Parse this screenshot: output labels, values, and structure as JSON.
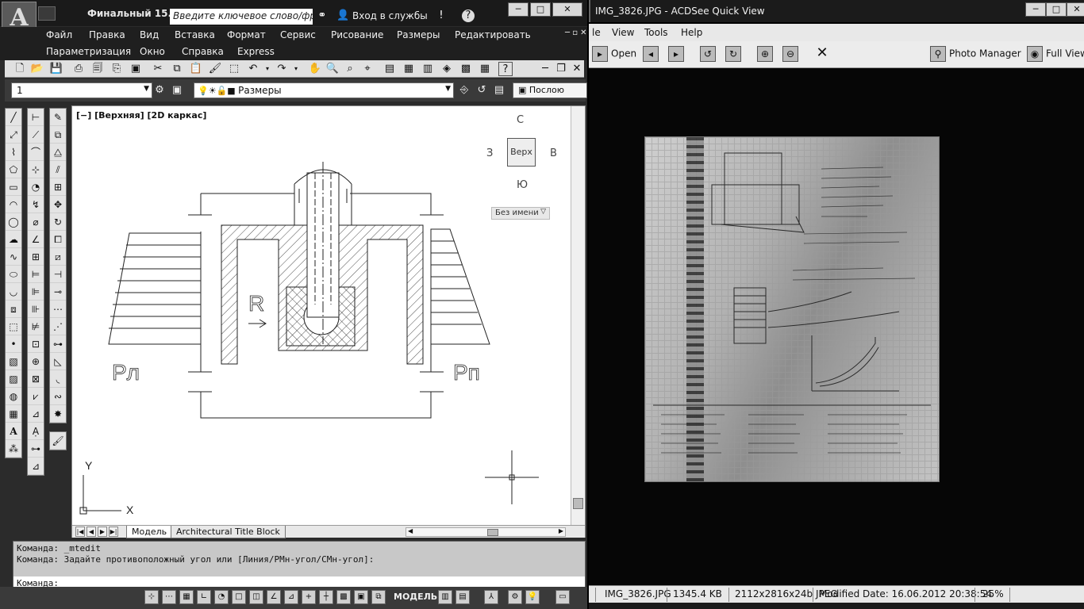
{
  "autocad": {
    "doc_title": "Финальный 15...",
    "search_placeholder": "Введите ключевое слово/фразу",
    "sign_in": "Вход в службы",
    "menu_row1": [
      "Файл",
      "Правка",
      "Вид",
      "Вставка",
      "Формат",
      "Сервис",
      "Рисование",
      "Размеры",
      "Редактировать"
    ],
    "menu_row2": [
      "Параметризация",
      "Окно",
      "Справка",
      "Express"
    ],
    "layer_value": "1",
    "dimstyle_value": "Размеры",
    "bylayer_value": "Послою",
    "viewport_label": "[−] [Верхняя] [2D каркас]",
    "viewcube": {
      "north": "С",
      "south": "Ю",
      "west": "З",
      "east": "В",
      "face": "Верх"
    },
    "view_name": "Без имени",
    "drawing_labels": {
      "left_pressure": "Рл",
      "right_pressure": "Рп",
      "radius": "R",
      "axis_x": "X",
      "axis_y": "Y"
    },
    "tabs": {
      "model": "Модель",
      "layout": "Architectural Title Block"
    },
    "command_history": [
      "Команда: _mtedit",
      "Команда: Задайте противоположный угол или [Линия/РМн-угол/СМн-угол]:"
    ],
    "command_prompt": "Команда:",
    "status_model": "МОДЕЛЬ"
  },
  "acdsee": {
    "title": "IMG_3826.JPG - ACDSee Quick View",
    "menu": [
      "le",
      "View",
      "Tools",
      "Help"
    ],
    "toolbar": {
      "open": "Open",
      "photo_manager": "Photo Manager",
      "full_view": "Full View"
    },
    "status": {
      "filename": "IMG_3826.JPG",
      "filesize": "1345.4 KB",
      "dimensions": "2112x2816x24b JPEG",
      "modified": "Modified Date: 16.06.2012 20:38:54",
      "zoom": "25%"
    }
  }
}
